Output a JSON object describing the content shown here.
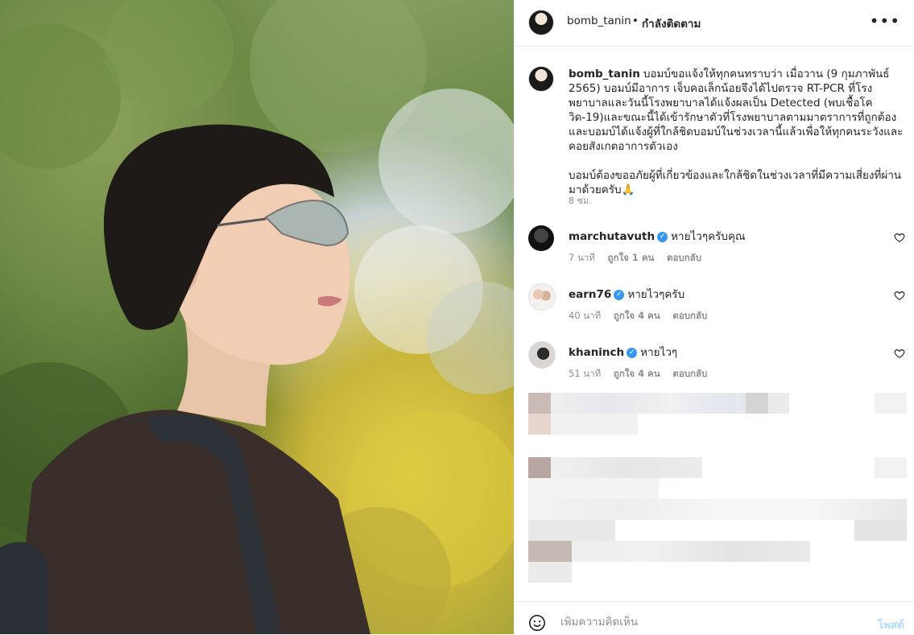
{
  "post": {
    "username": "bomb_tanin",
    "follow_status": "กำลังติดตาม",
    "separator": "•",
    "more_icon": "more-horizontal-icon"
  },
  "caption": {
    "username": "bomb_tanin",
    "paragraph1": "บอมบ์ขอแจ้งให้ทุกคนทราบว่า เมื่อวาน (9 กุมภาพันธ์ 2565) บอมบ์มีอาการ เจ็บคอเล็กน้อยจึงได้ไปตรวจ RT-PCR ที่โรงพยาบาลและวันนี้โรงพยาบาลได้แจ้งผลเป็น Detected (พบเชื้อโควิด-19)และขณะนี้ได้เข้ารักษาตัวที่โรงพยาบาลตามมาตราการที่ถูกต้องและบอมบ์ได้แจ้งผู้ที่ใกล้ชิดบอมบ์ในช่วงเวลานี้แล้วเพื่อให้ทุกคนระวังและคอยสังเกตอาการตัวเอง",
    "paragraph2": "บอมบ์ต้องขออภัยผู้ที่เกี่ยวข้องและใกล้ชิดในช่วงเวลาที่มีความเสี่ยงที่ผ่านมาด้วยครับ🙏",
    "time": "8 ชม."
  },
  "comments": [
    {
      "username": "marchutavuth",
      "text": "หายไวๆครับคุณ",
      "time": "7 นาที",
      "likes": "ถูกใจ 1 คน",
      "reply": "ตอบกลับ"
    },
    {
      "username": "earn76",
      "text": "หายไวๆครับ",
      "time": "40 นาที",
      "likes": "ถูกใจ 4 คน",
      "reply": "ตอบกลับ"
    },
    {
      "username": "khaninch",
      "text": "หายไวๆ",
      "time": "51 นาที",
      "likes": "ถูกใจ 4 คน",
      "reply": "ตอบกลับ"
    }
  ],
  "composer": {
    "placeholder": "เพิ่มความคิดเห็น",
    "post_label": "โพสต์"
  },
  "colors": {
    "verified": "#3897f0",
    "post_button_disabled": "#b3dbff",
    "muted": "#8e8e8e"
  }
}
